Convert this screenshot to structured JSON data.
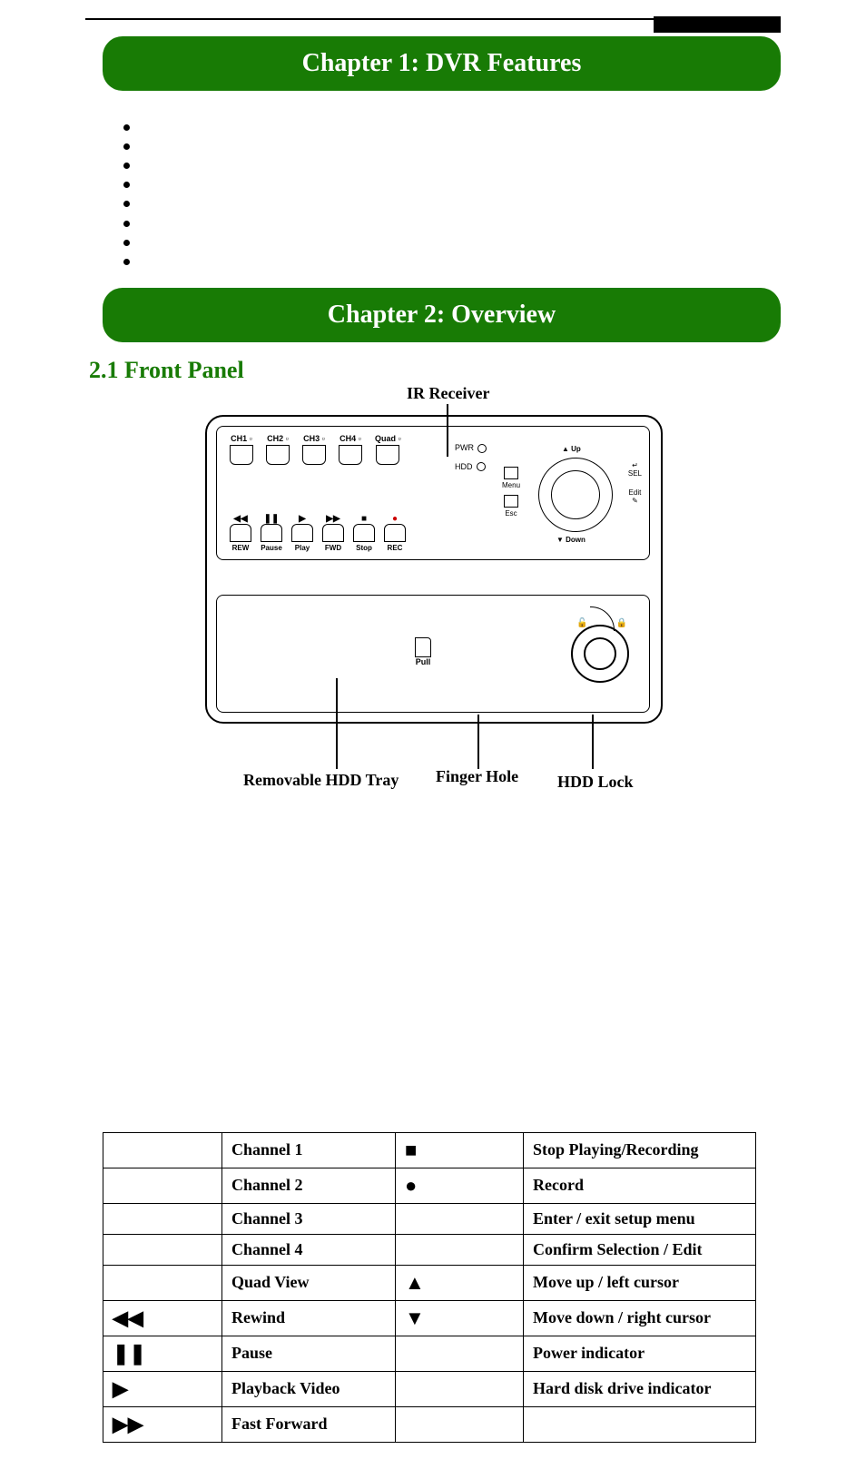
{
  "chapters": {
    "ch1_title": "Chapter 1: DVR Features",
    "ch2_title": "Chapter 2: Overview"
  },
  "section_21_heading": "2.1 Front Panel",
  "callouts": {
    "ir_receiver": "IR Receiver",
    "removable_hdd_tray": "Removable HDD Tray",
    "finger_hole": "Finger Hole",
    "hdd_lock": "HDD Lock"
  },
  "front_panel_labels": {
    "channels": [
      "CH1",
      "CH2",
      "CH3",
      "CH4",
      "Quad"
    ],
    "controls": [
      {
        "icon": "◀◀",
        "label": "REW"
      },
      {
        "icon": "❚❚",
        "label": "Pause"
      },
      {
        "icon": "▶",
        "label": "Play"
      },
      {
        "icon": "▶▶",
        "label": "FWD"
      },
      {
        "icon": "■",
        "label": "Stop"
      },
      {
        "icon": "●",
        "label": "REC"
      }
    ],
    "leds": {
      "pwr": "PWR",
      "hdd": "HDD"
    },
    "menu": "Menu",
    "esc": "Esc",
    "up": "▲ Up",
    "down": "▼ Down",
    "sel": "SEL",
    "edit": "Edit",
    "pull": "Pull"
  },
  "legend_rows": [
    {
      "icon_left": "",
      "desc_left": "Channel 1",
      "icon_right": "■",
      "desc_right": "Stop Playing/Recording"
    },
    {
      "icon_left": "",
      "desc_left": "Channel 2",
      "icon_right": "●",
      "desc_right": "Record"
    },
    {
      "icon_left": "",
      "desc_left": "Channel 3",
      "icon_right": "",
      "desc_right": "Enter / exit setup menu"
    },
    {
      "icon_left": "",
      "desc_left": "Channel 4",
      "icon_right": "",
      "desc_right": "Confirm Selection / Edit"
    },
    {
      "icon_left": "",
      "desc_left": "Quad View",
      "icon_right": "▲",
      "desc_right": "Move up / left cursor"
    },
    {
      "icon_left": "◀◀",
      "desc_left": "Rewind",
      "icon_right": "▼",
      "desc_right": "Move down / right cursor"
    },
    {
      "icon_left": "❚❚",
      "desc_left": "Pause",
      "icon_right": "",
      "desc_right": "Power indicator"
    },
    {
      "icon_left": "▶",
      "desc_left": "Playback Video",
      "icon_right": "",
      "desc_right": "Hard disk drive indicator"
    },
    {
      "icon_left": "▶▶",
      "desc_left": "Fast Forward",
      "icon_right": "",
      "desc_right": ""
    }
  ]
}
